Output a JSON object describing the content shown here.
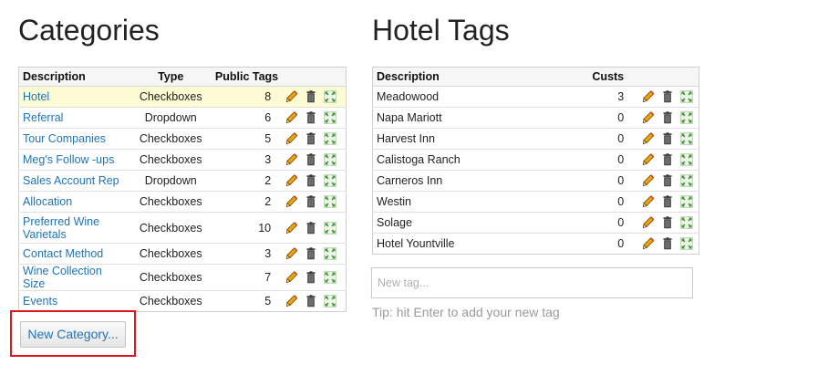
{
  "categories": {
    "title": "Categories",
    "headers": {
      "description": "Description",
      "type": "Type",
      "public_tags": "Public Tags"
    },
    "rows": [
      {
        "description": "Hotel",
        "type": "Checkboxes",
        "tags": "8"
      },
      {
        "description": "Referral",
        "type": "Dropdown",
        "tags": "6"
      },
      {
        "description": "Tour Companies",
        "type": "Checkboxes",
        "tags": "5"
      },
      {
        "description": "Meg's Follow -ups",
        "type": "Checkboxes",
        "tags": "3"
      },
      {
        "description": "Sales Account Rep",
        "type": "Dropdown",
        "tags": "2"
      },
      {
        "description": "Allocation",
        "type": "Checkboxes",
        "tags": "2"
      },
      {
        "description": "Preferred Wine Varietals",
        "type": "Checkboxes",
        "tags": "10"
      },
      {
        "description": "Contact Method",
        "type": "Checkboxes",
        "tags": "3"
      },
      {
        "description": "Wine Collection Size",
        "type": "Checkboxes",
        "tags": "7"
      },
      {
        "description": "Events",
        "type": "Checkboxes",
        "tags": "5"
      }
    ],
    "new_button_label": "New Category..."
  },
  "hotel_tags": {
    "title": "Hotel Tags",
    "headers": {
      "description": "Description",
      "custs": "Custs"
    },
    "rows": [
      {
        "description": "Meadowood",
        "custs": "3"
      },
      {
        "description": "Napa Mariott",
        "custs": "0"
      },
      {
        "description": "Harvest Inn",
        "custs": "0"
      },
      {
        "description": "Calistoga Ranch",
        "custs": "0"
      },
      {
        "description": "Carneros Inn",
        "custs": "0"
      },
      {
        "description": "Westin",
        "custs": "0"
      },
      {
        "description": "Solage",
        "custs": "0"
      },
      {
        "description": "Hotel Yountville",
        "custs": "0"
      }
    ],
    "input_placeholder": "New tag...",
    "tip": "Tip: hit Enter to add your new tag"
  },
  "icons": {
    "edit": "pencil-icon",
    "delete": "trash-icon",
    "move": "move-arrows-icon"
  },
  "colors": {
    "link": "#1f73b7",
    "highlight_row": "#fdfbd3",
    "annotation_box": "#e0141c"
  }
}
